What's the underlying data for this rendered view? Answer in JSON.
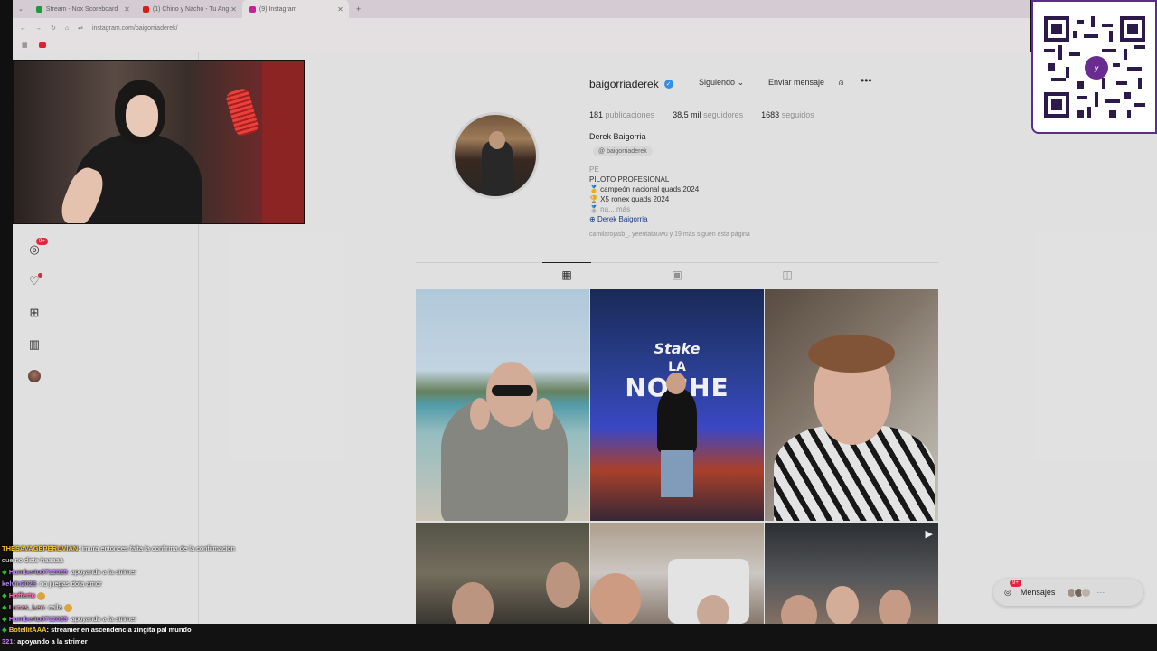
{
  "browser": {
    "tabs": [
      {
        "label": "Stream - Nox Scoreboard",
        "color": "#1ea446"
      },
      {
        "label": "(1) Chino y Nacho - Tu Ang",
        "color": "#e62117"
      },
      {
        "label": "(9) Instagram",
        "color": "#d6249f"
      }
    ],
    "address": "instagram.com/baigorriaderek/"
  },
  "profile": {
    "username": "baigorriaderek",
    "following_label": "Siguiendo",
    "message_label": "Enviar mensaje",
    "stats": {
      "posts_value": "181",
      "posts_label": "publicaciones",
      "followers_value": "38,5 mil",
      "followers_label": "seguidores",
      "following_value": "1683",
      "following_label": "seguidos"
    },
    "full_name": "Derek Baigorria",
    "threads_handle": "baigorriaderek",
    "bio": {
      "line1": "PE",
      "line2": "PILOTO PROFESIONAL",
      "line3": "🥇 campeón nacional quads 2024",
      "line4": "🏆 X5 ronex quads 2024",
      "line5": "🥈 na... más",
      "link": "Derek Baigorria"
    },
    "followed_by": "camilarojasb_, yeentatauwu y 19 más siguen esta página"
  },
  "sidebar": {
    "notif_badge": "9+"
  },
  "post_2": {
    "brand": "Stake",
    "title_top": "LA",
    "title_bottom": "NOCHE"
  },
  "messages": {
    "label": "Mensajes",
    "badge": "9+"
  },
  "chat": [
    {
      "user": "THESAVAGEPERUVIAN",
      "color": "#f4c542",
      "text": ": imura entonces falta la confirma de la confirmacion"
    },
    {
      "user": "",
      "color": "#ffffff",
      "text": "que no diste haaaaa"
    },
    {
      "user": "Humberto0712025",
      "color": "#c67bff",
      "text": ": apoyando a la strimer"
    },
    {
      "user": "kelvin2025",
      "color": "#b88cff",
      "text": ": no juegas dota amor"
    },
    {
      "user": "Hofferto",
      "color": "#ff6eb4",
      "text": ""
    },
    {
      "user": "Lucas_Leo",
      "color": "#ff8fc0",
      "text": ": calla"
    },
    {
      "user": "Humberto0712025",
      "color": "#c67bff",
      "text": ": apoyando a la strimer"
    }
  ],
  "bottom_chat": [
    {
      "user": "BotellitAAA",
      "color": "#f4c542",
      "text": ": streamer en ascendencia zingita pal mundo"
    },
    {
      "user": "321",
      "color": "#c67bff",
      "text": ": apoyando a la strimer"
    }
  ],
  "colors": {
    "ig_bg": "#efefef",
    "verified": "#3897f0",
    "badge": "#ef2a43",
    "yape": "#6a2c91"
  }
}
